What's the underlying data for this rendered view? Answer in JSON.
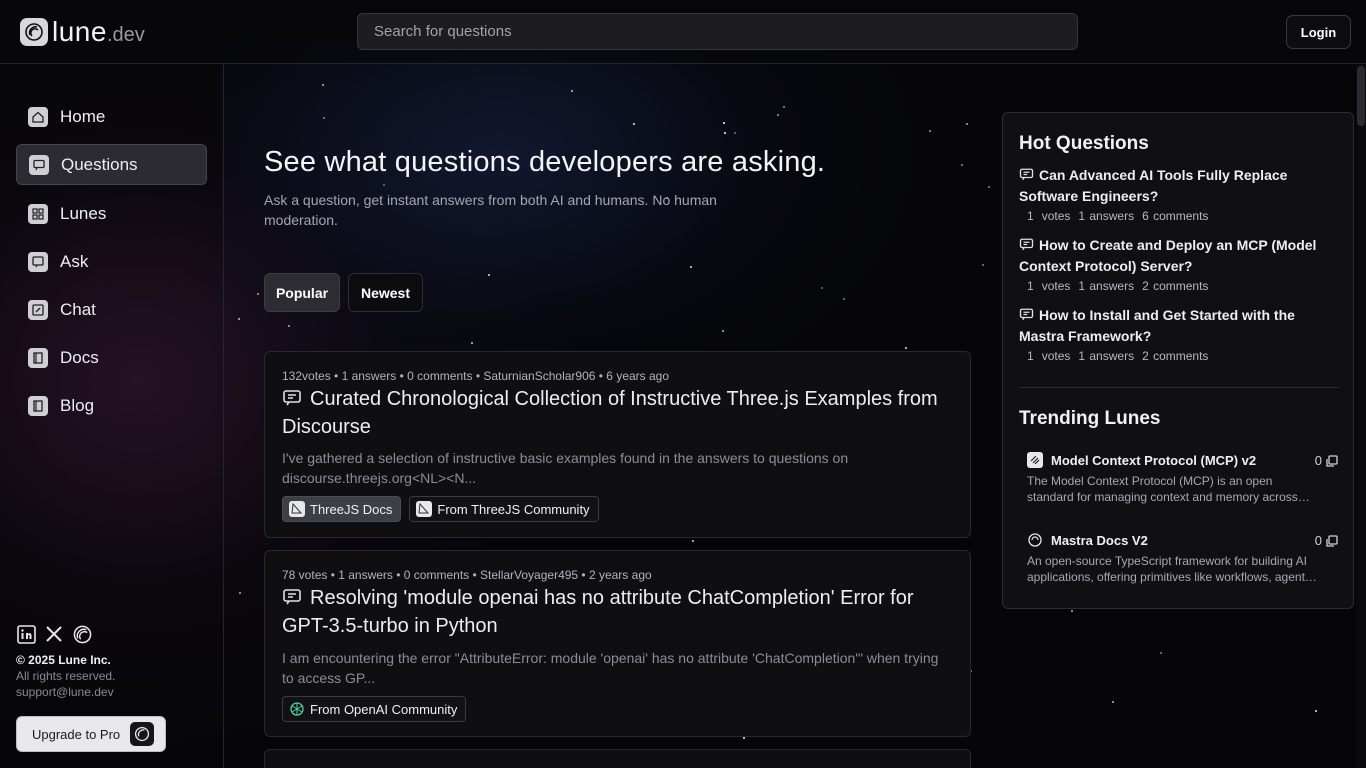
{
  "header": {
    "logo_name": "lune",
    "logo_tld": ".dev",
    "search_placeholder": "Search for questions",
    "login_label": "Login"
  },
  "sidebar": {
    "items": [
      {
        "label": "Home",
        "icon": "home-icon"
      },
      {
        "label": "Questions",
        "icon": "questions-icon",
        "active": true
      },
      {
        "label": "Lunes",
        "icon": "grid-icon"
      },
      {
        "label": "Ask",
        "icon": "ask-icon"
      },
      {
        "label": "Chat",
        "icon": "chat-edit-icon"
      },
      {
        "label": "Docs",
        "icon": "book-icon"
      },
      {
        "label": "Blog",
        "icon": "book-icon"
      }
    ],
    "social": [
      "linkedin-icon",
      "x-icon",
      "lune-icon"
    ],
    "copyright": "© 2025 Lune Inc.",
    "rights": "All rights reserved.",
    "support": "support@lune.dev",
    "upgrade_label": "Upgrade to Pro"
  },
  "hero": {
    "title": "See what questions developers are asking.",
    "subtitle": "Ask a question, get instant answers from both AI and humans. No human moderation."
  },
  "tabs": [
    {
      "label": "Popular",
      "active": true
    },
    {
      "label": "Newest",
      "active": false
    }
  ],
  "questions": [
    {
      "meta": "132votes • 1 answers • 0 comments • SaturnianScholar906 • 6 years ago",
      "title": "Curated Chronological Collection of Instructive Three.js Examples from Discourse",
      "excerpt": "I've gathered a selection of instructive basic examples found in the answers to questions on discourse.threejs.org<NL><N...",
      "tags": [
        "ThreeJS Docs",
        "From ThreeJS Community"
      ]
    },
    {
      "meta": " 78 votes • 1 answers • 0 comments • StellarVoyager495 • 2 years ago",
      "title": "Resolving 'module openai has no attribute ChatCompletion' Error for GPT-3.5-turbo in Python",
      "excerpt": "I am encountering the error \"AttributeError: module 'openai' has no attribute 'ChatCompletion'\" when trying to access GP...",
      "tags": [
        "From OpenAI Community"
      ]
    }
  ],
  "hot": {
    "heading": "Hot Questions",
    "items": [
      {
        "title": "Can Advanced AI Tools Fully Replace Software Engineers?",
        "votes": "1",
        "votes_label": "votes",
        "answers": "1 answers",
        "comments": "6 comments"
      },
      {
        "title": "How to Create and Deploy an MCP (Model Context Protocol) Server?",
        "votes": "1",
        "votes_label": "votes",
        "answers": "1 answers",
        "comments": "2 comments"
      },
      {
        "title": "How to Install and Get Started with the Mastra Framework?",
        "votes": "1",
        "votes_label": "votes",
        "answers": "1 answers",
        "comments": "2 comments"
      }
    ]
  },
  "trending": {
    "heading": "Trending Lunes",
    "items": [
      {
        "name": "Model Context Protocol (MCP) v2",
        "count": "0",
        "desc": "The Model Context Protocol (MCP) is an open standard for managing context and memory across large language model applications."
      },
      {
        "name": "Mastra Docs V2",
        "count": "0",
        "desc": "An open-source TypeScript framework for building AI applications, offering primitives like workflows, agents and RAG."
      }
    ]
  }
}
